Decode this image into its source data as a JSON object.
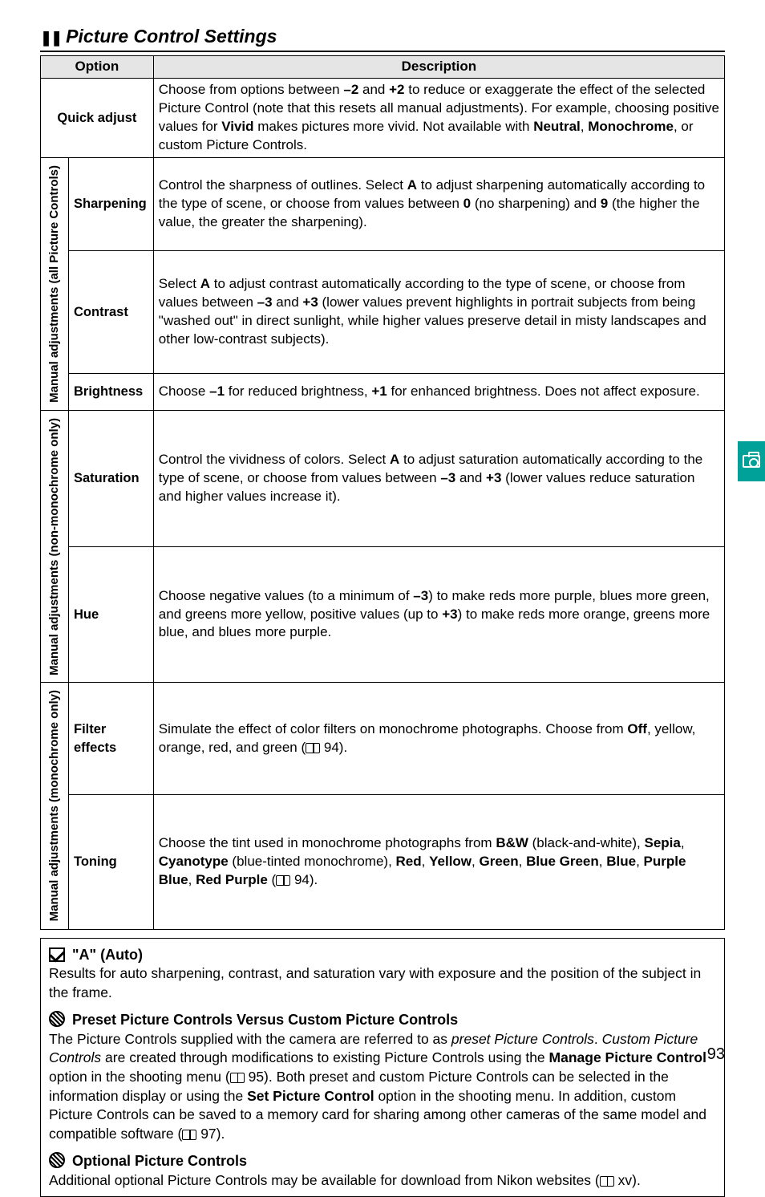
{
  "section_title": "Picture Control Settings",
  "page_number": "93",
  "table": {
    "head_option": "Option",
    "head_description": "Description",
    "quick_adjust": {
      "label": "Quick adjust",
      "desc_pre": "Choose from options between ",
      "v1": "–2",
      "mid1": " and ",
      "v2": "+2",
      "mid2": " to reduce or exaggerate the effect of the selected Picture Control (note that this resets all manual adjustments). For example, choosing positive values for ",
      "bold_vivid": "Vivid",
      "mid3": " makes pictures more vivid. Not available with ",
      "bold_neutral": "Neutral",
      "c1": ", ",
      "bold_mono": "Monochrome",
      "tail": ", or custom Picture Controls."
    },
    "group1_label": "Manual adjustments\n(all Picture Controls)",
    "sharpening": {
      "label": "Sharpening",
      "pre": "Control the sharpness of outlines.  Select ",
      "A": "A",
      "mid": " to adjust sharpening automatically according to the type of scene, or choose from values between ",
      "v0": "0",
      "mid2": " (no sharpening) and ",
      "v9": "9",
      "tail": " (the higher the value, the greater the sharpening)."
    },
    "contrast": {
      "label": "Contrast",
      "pre": "Select ",
      "A": "A",
      "mid1": " to adjust contrast automatically according to the type of scene, or choose from values between ",
      "v1": "–3",
      "mid2": " and ",
      "v2": "+3",
      "tail": " (lower values prevent highlights in portrait subjects from being \"washed out\" in direct sunlight, while higher values preserve detail in misty landscapes and other low-contrast subjects)."
    },
    "brightness": {
      "label": "Brightness",
      "pre": "Choose ",
      "v1": "–1",
      "mid1": " for reduced brightness, ",
      "v2": "+1",
      "tail": " for enhanced brightness.  Does not affect exposure."
    },
    "group2_label": "Manual adjustments\n(non-monochrome only)",
    "saturation": {
      "label": "Saturation",
      "pre": "Control the vividness of colors.  Select ",
      "A": "A",
      "mid1": " to adjust saturation automatically according to the type of scene, or choose from values between ",
      "v1": "–3",
      "mid2": " and ",
      "v2": "+3",
      "tail": " (lower values reduce saturation and higher values increase it)."
    },
    "hue": {
      "label": "Hue",
      "pre": "Choose negative values (to a minimum of ",
      "v1": "–3",
      "mid1": ") to make reds more purple, blues more green, and greens more yellow, positive values (up to ",
      "v2": "+3",
      "tail": ") to make reds more orange, greens more blue, and blues more purple."
    },
    "group3_label": "Manual adjustments\n(monochrome only)",
    "filter": {
      "label": "Filter effects",
      "pre": "Simulate the effect of color filters on monochrome photographs.  Choose from ",
      "off": "Off",
      "tail1": ", yellow, orange, red, and green (",
      "ref": " 94",
      "tail2": ")."
    },
    "toning": {
      "label": "Toning",
      "pre": "Choose the tint used in monochrome photographs from ",
      "bw": "B&W",
      "mid1": " (black-and-white), ",
      "sep": "Sepia",
      "c1": ", ",
      "cyan": "Cyanotype",
      "mid2": " (blue-tinted monochrome), ",
      "red": "Red",
      "c2": ", ",
      "yel": "Yellow",
      "c3": ", ",
      "grn": "Green",
      "c4": ", ",
      "bg": "Blue Green",
      "c5": ", ",
      "blue": "Blue",
      "c6": ", ",
      "pb": "Purple Blue",
      "c7": ", ",
      "rp": "Red Purple",
      "tail1": " (",
      "ref": " 94",
      "tail2": ")."
    }
  },
  "notes": {
    "auto": {
      "title": " \"A\" (Auto)",
      "body": "Results for auto sharpening, contrast, and saturation vary with exposure and the position of the subject in the frame."
    },
    "preset": {
      "title": " Preset Picture Controls Versus Custom Picture Controls",
      "s1": "The Picture Controls supplied with the camera are referred to as ",
      "it1": "preset Picture Controls",
      "s2": ". ",
      "it2": "Custom Picture Controls",
      "s3": " are created through modifications to existing Picture Controls using the ",
      "b1": "Manage Picture Control",
      "s4": " option in the shooting menu (",
      "ref1": " 95",
      "s5": ").  Both preset and custom Picture Controls can be selected in the information display or using the ",
      "b2": "Set Picture Control",
      "s6": " option in the shooting menu.  In addition, custom Picture Controls can be saved to a memory card for sharing among other cameras of the same model and compatible software (",
      "ref2": " 97",
      "s7": ")."
    },
    "optional": {
      "title": " Optional Picture Controls",
      "s1": "Additional optional Picture Controls may be available for download from Nikon websites (",
      "ref": " xv",
      "s2": ")."
    }
  }
}
